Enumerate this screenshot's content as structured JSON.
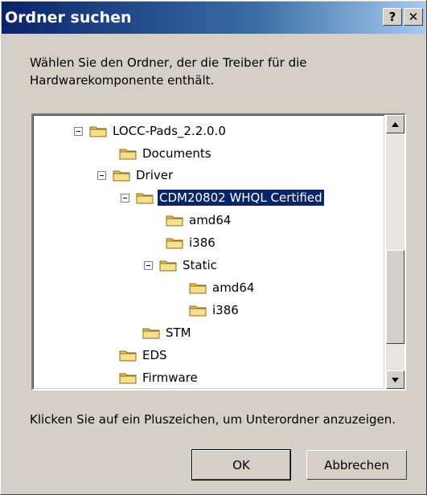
{
  "window": {
    "title": "Ordner suchen",
    "help_button": "?",
    "close_button": "✕"
  },
  "instruction": "Wählen Sie den Ordner, der die Treiber für die\nHardwarekomponente enthält.",
  "tree": {
    "items": [
      {
        "label": "LOCC-Pads_2.2.0.0"
      },
      {
        "label": "Documents"
      },
      {
        "label": "Driver"
      },
      {
        "label": "CDM20802 WHQL Certified"
      },
      {
        "label": "amd64"
      },
      {
        "label": "i386"
      },
      {
        "label": "Static"
      },
      {
        "label": "amd64"
      },
      {
        "label": "i386"
      },
      {
        "label": "STM"
      },
      {
        "label": "EDS"
      },
      {
        "label": "Firmware"
      }
    ]
  },
  "hint": "Klicken Sie auf ein Pluszeichen, um Unterordner anzuzeigen.",
  "buttons": {
    "ok": "OK",
    "cancel": "Abbrechen"
  },
  "colors": {
    "title_gradient_start": "#0a246a",
    "title_gradient_end": "#a6caf0",
    "selection": "#0a246a",
    "dialog_face": "#d4d0c8"
  },
  "icons": {
    "folder": "folder-icon",
    "expander": "collapse-minus-icon",
    "scroll_up": "arrow-up-icon",
    "scroll_down": "arrow-down-icon"
  }
}
